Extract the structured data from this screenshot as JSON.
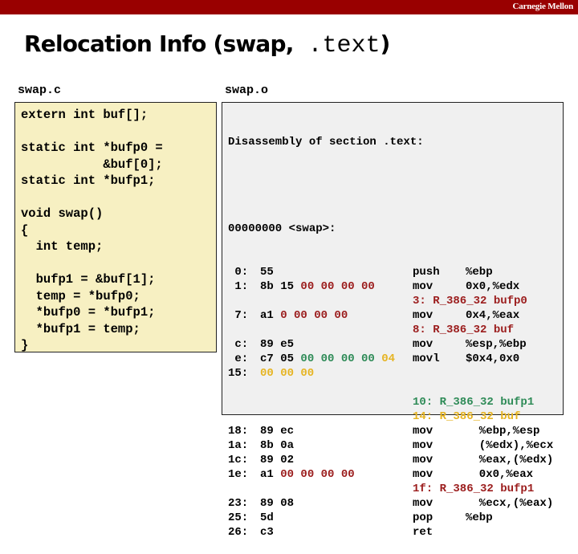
{
  "header": {
    "brand": "Carnegie Mellon",
    "title_prefix": "Relocation Info (swap,  ",
    "title_mono": ".text",
    "title_suffix": ")"
  },
  "colors": {
    "topbar": "#990000",
    "c_box_bg": "#f7f0c2",
    "o_box_bg": "#f0f0f0",
    "reloc_red": "#9b1c1c",
    "reloc_green": "#2e8b57",
    "reloc_gold": "#e6b422"
  },
  "left_panel": {
    "label": "swap.c",
    "lines": [
      "extern int buf[];",
      "",
      "static int *bufp0 =",
      "           &buf[0];",
      "static int *bufp1;",
      "",
      "void swap()",
      "{",
      "  int temp;",
      "",
      "  bufp1 = &buf[1];",
      "  temp = *bufp0;",
      "  *bufp0 = *bufp1;",
      "  *bufp1 = temp;",
      "}"
    ]
  },
  "right_panel": {
    "label": "swap.o",
    "heading": "Disassembly of section .text:",
    "symbol": "00000000 <swap>:",
    "rows": [
      {
        "addr": " 0:",
        "bytes": [
          {
            "t": "55",
            "c": ""
          }
        ],
        "op": "push",
        "args": "%ebp"
      },
      {
        "addr": " 1:",
        "bytes": [
          {
            "t": "8b 15 ",
            "c": ""
          },
          {
            "t": "00 00 00 00",
            "c": "red"
          }
        ],
        "op": "mov",
        "args": "0x0,%edx"
      },
      {
        "reloc": "3: R_386_32 bufp0",
        "c": "red"
      },
      {
        "addr": " 7:",
        "bytes": [
          {
            "t": "a1 ",
            "c": ""
          },
          {
            "t": "0 00 00 00",
            "c": "red"
          }
        ],
        "op": "mov",
        "args": "0x4,%eax"
      },
      {
        "reloc": "8: R_386_32 buf",
        "c": "red"
      },
      {
        "addr": " c:",
        "bytes": [
          {
            "t": "89 e5",
            "c": ""
          }
        ],
        "op": "mov",
        "args": "%esp,%ebp"
      },
      {
        "addr": " e:",
        "bytes": [
          {
            "t": "c7 05 ",
            "c": ""
          },
          {
            "t": "00 00 00 00 ",
            "c": "green"
          },
          {
            "t": "04",
            "c": "gold"
          }
        ],
        "op": "movl",
        "args": "$0x4,0x0"
      },
      {
        "addr": "15:",
        "bytes": [
          {
            "t": "00 00 00",
            "c": "gold"
          }
        ],
        "op": "",
        "args": ""
      },
      {
        "reloc": "",
        "c": ""
      },
      {
        "reloc": "10: R_386_32 bufp1",
        "c": "green"
      },
      {
        "reloc": "14: R_386_32 buf",
        "c": "gold"
      },
      {
        "addr": "18:",
        "bytes": [
          {
            "t": "89 ec",
            "c": ""
          }
        ],
        "op": "mov",
        "args": "  %ebp,%esp"
      },
      {
        "addr": "1a:",
        "bytes": [
          {
            "t": "8b 0a",
            "c": ""
          }
        ],
        "op": "mov",
        "args": "  (%edx),%ecx"
      },
      {
        "addr": "1c:",
        "bytes": [
          {
            "t": "89 02",
            "c": ""
          }
        ],
        "op": "mov",
        "args": "  %eax,(%edx)"
      },
      {
        "addr": "1e:",
        "bytes": [
          {
            "t": "a1 ",
            "c": ""
          },
          {
            "t": "00 00 00 00",
            "c": "red"
          }
        ],
        "op": "mov",
        "args": "  0x0,%eax"
      },
      {
        "reloc": "1f: R_386_32 bufp1",
        "c": "red"
      },
      {
        "addr": "23:",
        "bytes": [
          {
            "t": "89 08",
            "c": ""
          }
        ],
        "op": "mov",
        "args": "  %ecx,(%eax)"
      },
      {
        "addr": "25:",
        "bytes": [
          {
            "t": "5d",
            "c": ""
          }
        ],
        "op": "pop",
        "args": "%ebp"
      },
      {
        "addr": "26:",
        "bytes": [
          {
            "t": "c3",
            "c": ""
          }
        ],
        "op": "ret",
        "args": ""
      }
    ]
  }
}
